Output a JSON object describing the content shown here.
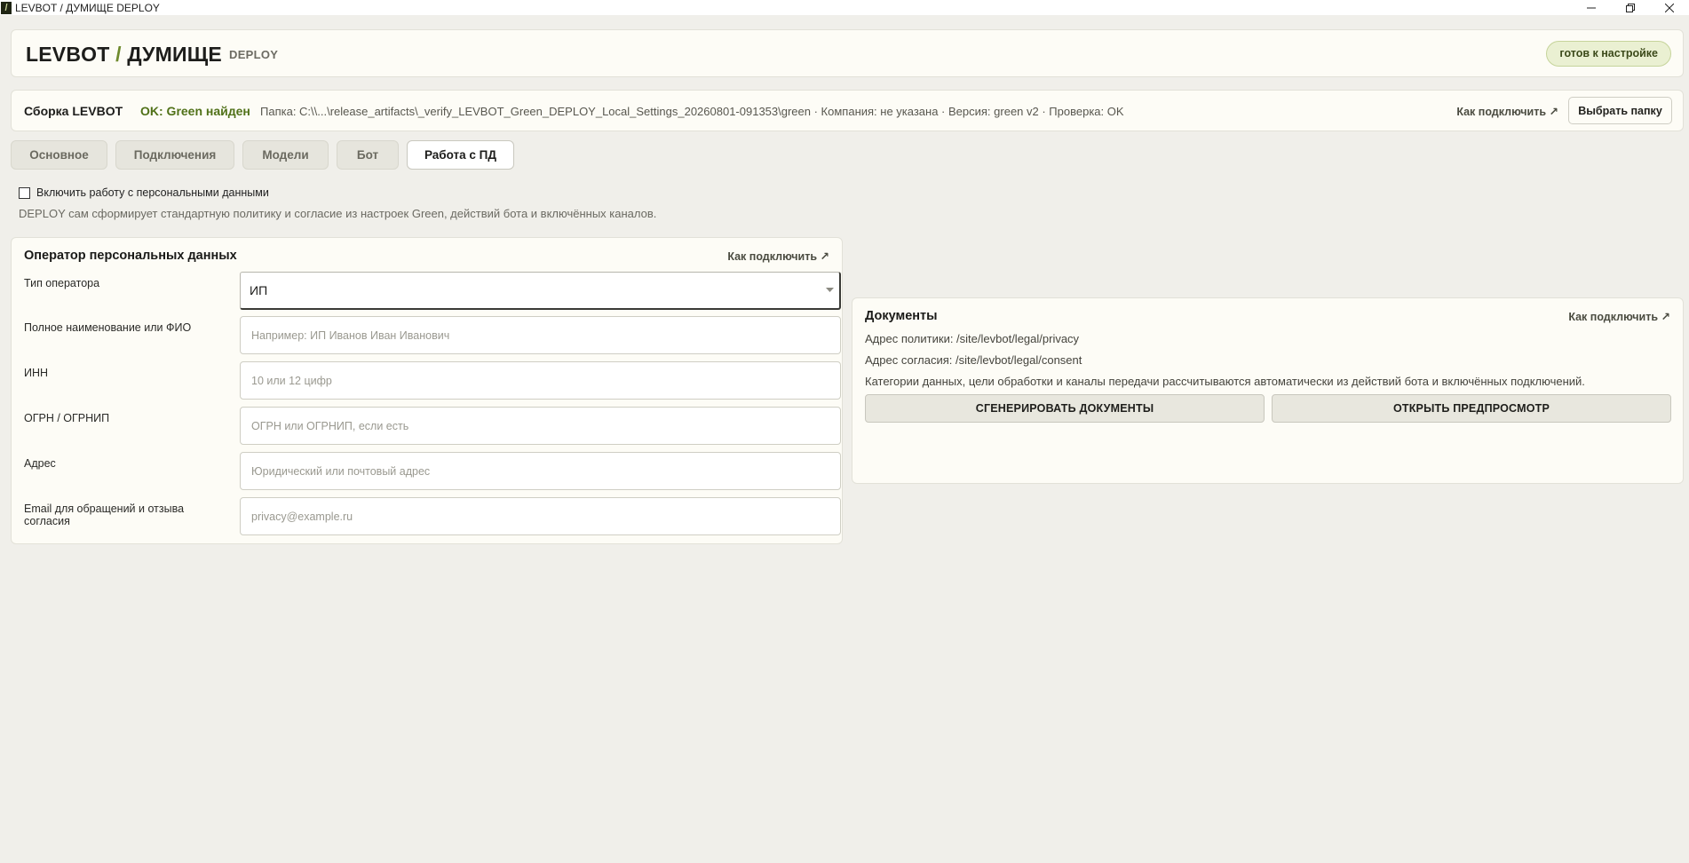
{
  "window": {
    "title": "LEVBOT / ДУМИЩЕ DEPLOY",
    "icon_glyph": "/"
  },
  "header": {
    "brand_left": "LEVBOT",
    "brand_slash": "/",
    "brand_right": "ДУМИЩЕ",
    "brand_sub": "DEPLOY",
    "status_badge": "готов к настройке"
  },
  "build": {
    "title": "Сборка LEVBOT",
    "status": "OK: Green найден",
    "meta": "Папка: C:\\\\...\\release_artifacts\\_verify_LEVBOT_Green_DEPLOY_Local_Settings_20260801-091353\\green  ·  Компания: не указана  ·  Версия: green v2  ·  Проверка: OK",
    "connect_link": "Как подключить ↗",
    "choose_folder": "Выбрать папку"
  },
  "tabs": [
    {
      "label": "Основное",
      "active": false
    },
    {
      "label": "Подключения",
      "active": false
    },
    {
      "label": "Модели",
      "active": false
    },
    {
      "label": "Бот",
      "active": false
    },
    {
      "label": "Работа с ПД",
      "active": true
    }
  ],
  "consent": {
    "checkbox_label": "Включить работу с персональными данными",
    "checked": false,
    "note": "DEPLOY сам сформирует стандартную политику и согласие из настроек Green, действий бота и включённых каналов."
  },
  "operator": {
    "heading": "Оператор персональных данных",
    "connect_link": "Как подключить ↗",
    "type_label": "Тип оператора",
    "type_value": "ИП",
    "fields": [
      {
        "label": "Полное наименование или ФИО",
        "value": "",
        "placeholder": "Например: ИП Иванов Иван Иванович"
      },
      {
        "label": "ИНН",
        "value": "",
        "placeholder": "10 или 12 цифр"
      },
      {
        "label": "ОГРН / ОГРНИП",
        "value": "",
        "placeholder": "ОГРН или ОГРНИП, если есть"
      },
      {
        "label": "Адрес",
        "value": "",
        "placeholder": "Юридический или почтовый адрес"
      },
      {
        "label": "Email для обращений и отзыва согласия",
        "value": "",
        "placeholder": "privacy@example.ru"
      }
    ]
  },
  "documents": {
    "heading": "Документы",
    "connect_link": "Как подключить ↗",
    "policy_line": "Адрес политики: /site/levbot/legal/privacy",
    "consent_line": "Адрес согласия: /site/levbot/legal/consent",
    "info_line": "Категории данных, цели обработки и каналы передачи рассчитываются автоматически из действий бота и включённых подключений.",
    "generate_button": "СГЕНЕРИРОВАТЬ ДОКУМЕНТЫ",
    "preview_button": "ОТКРЫТЬ ПРЕДПРОСМОТР"
  },
  "colors": {
    "background": "#f0efea",
    "panel": "#fdfcf6",
    "accent_green": "#507118",
    "badge_bg": "#eaf0d2"
  }
}
